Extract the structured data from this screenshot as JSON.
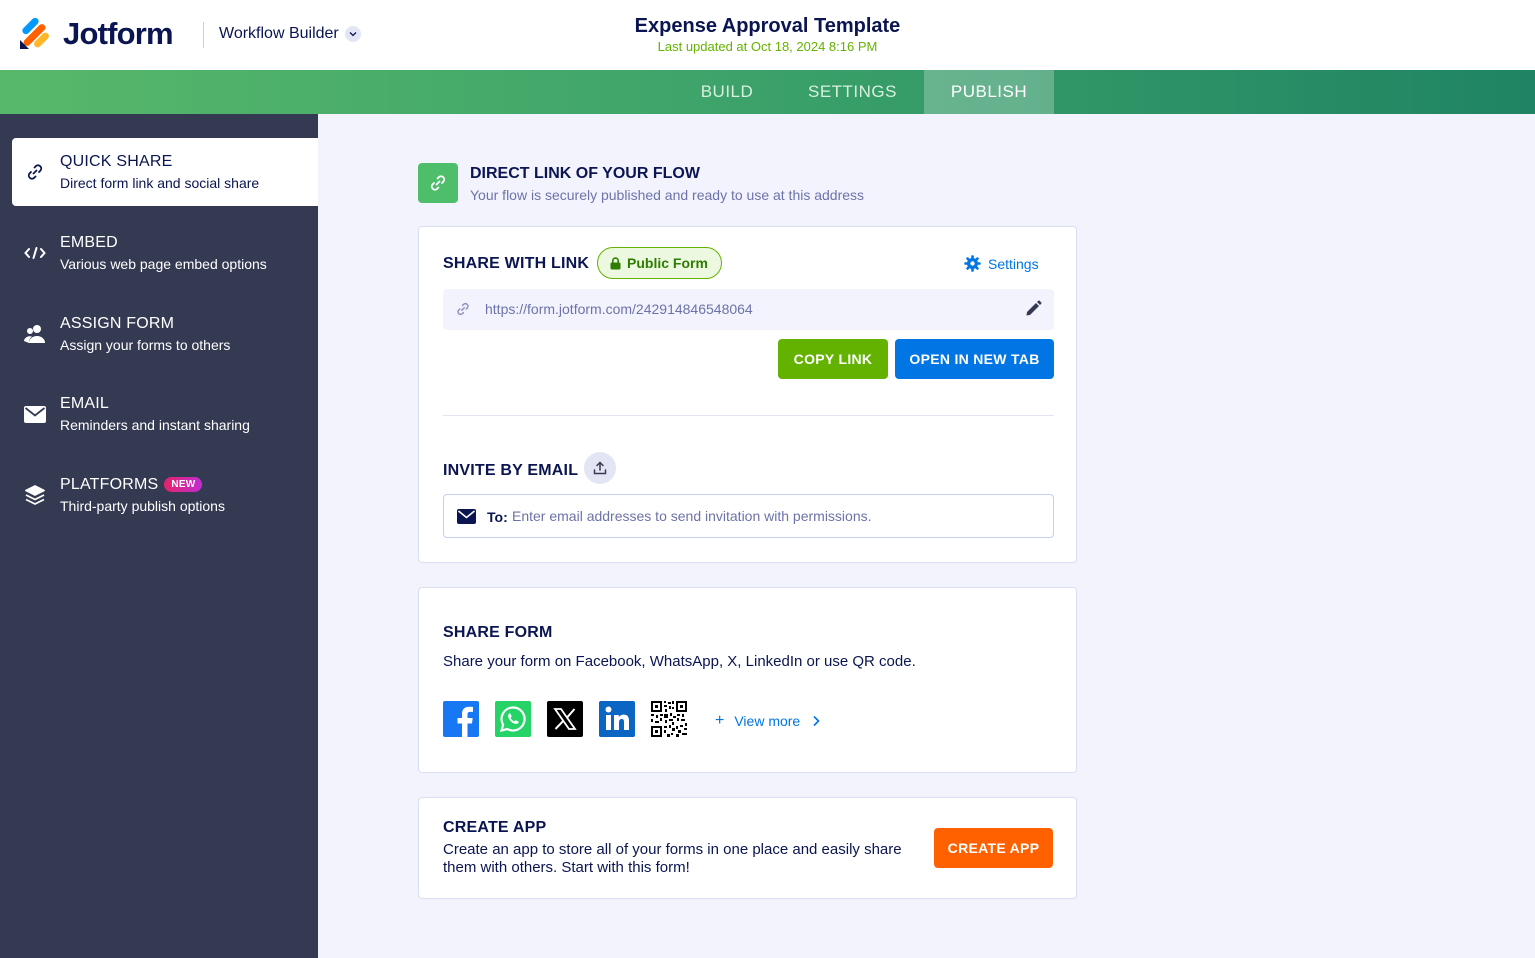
{
  "header": {
    "logo_text": "Jotform",
    "builder_label": "Workflow Builder",
    "title": "Expense Approval Template",
    "updated": "Last updated at Oct 18, 2024 8:16 PM"
  },
  "tabs": [
    {
      "label": "BUILD"
    },
    {
      "label": "SETTINGS"
    },
    {
      "label": "PUBLISH",
      "active": true
    }
  ],
  "sidebar": {
    "items": [
      {
        "title": "QUICK SHARE",
        "subtitle": "Direct form link and social share",
        "icon": "link-icon",
        "active": true
      },
      {
        "title": "EMBED",
        "subtitle": "Various web page embed options",
        "icon": "code-icon"
      },
      {
        "title": "ASSIGN FORM",
        "subtitle": "Assign your forms to others",
        "icon": "users-icon"
      },
      {
        "title": "EMAIL",
        "subtitle": "Reminders and instant sharing",
        "icon": "envelope-icon"
      },
      {
        "title": "PLATFORMS",
        "subtitle": "Third-party publish options",
        "icon": "layers-icon",
        "badge": "NEW"
      }
    ]
  },
  "direct_link": {
    "title": "DIRECT LINK OF YOUR FLOW",
    "subtitle": "Your flow is securely published and ready to use at this address"
  },
  "share_link": {
    "title": "SHARE WITH LINK",
    "badge": "Public Form",
    "settings_label": "Settings",
    "url": "https://form.jotform.com/242914846548064",
    "copy_label": "COPY LINK",
    "open_label": "OPEN IN NEW TAB"
  },
  "invite": {
    "title": "INVITE BY EMAIL",
    "to_label": "To:",
    "placeholder": "Enter email addresses to send invitation with permissions."
  },
  "share_form": {
    "title": "SHARE FORM",
    "description": "Share your form on Facebook, WhatsApp, X, LinkedIn or use QR code.",
    "socials": [
      "facebook-icon",
      "whatsapp-icon",
      "x-icon",
      "linkedin-icon",
      "qr-code-icon"
    ],
    "view_more": "View more"
  },
  "create_app": {
    "title": "CREATE APP",
    "description": "Create an app to store all of your forms in one place and easily share them with others. Start with this form!",
    "button": "CREATE APP"
  },
  "colors": {
    "navy": "#0a1551",
    "green": "#64b200",
    "blue": "#0075e3",
    "orange": "#ff6100",
    "sidebar": "#343a52"
  }
}
